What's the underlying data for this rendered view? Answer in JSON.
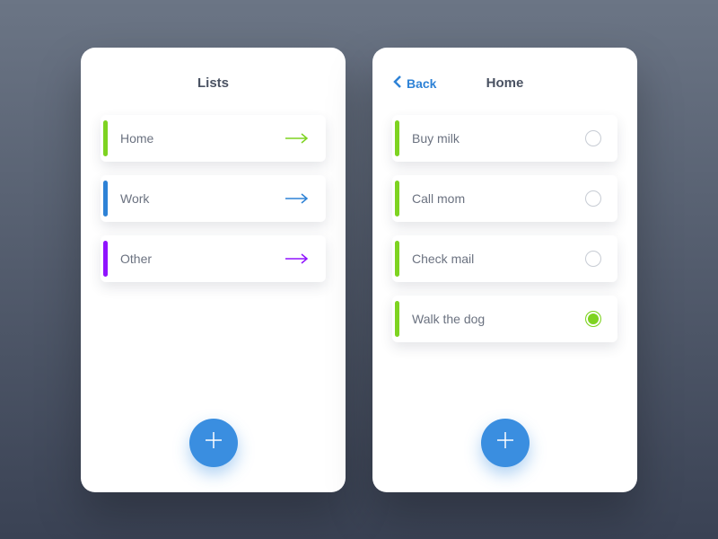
{
  "left": {
    "title": "Lists",
    "items": [
      {
        "label": "Home",
        "color": "#7ed321",
        "arrow": "#7ed321"
      },
      {
        "label": "Work",
        "color": "#2e82d6",
        "arrow": "#2e82d6"
      },
      {
        "label": "Other",
        "color": "#9013fe",
        "arrow": "#9013fe"
      }
    ]
  },
  "right": {
    "back_label": "Back",
    "title": "Home",
    "accent_color": "#7ed321",
    "items": [
      {
        "label": "Buy milk",
        "done": false
      },
      {
        "label": "Call mom",
        "done": false
      },
      {
        "label": "Check mail",
        "done": false
      },
      {
        "label": "Walk the dog",
        "done": true
      }
    ]
  }
}
